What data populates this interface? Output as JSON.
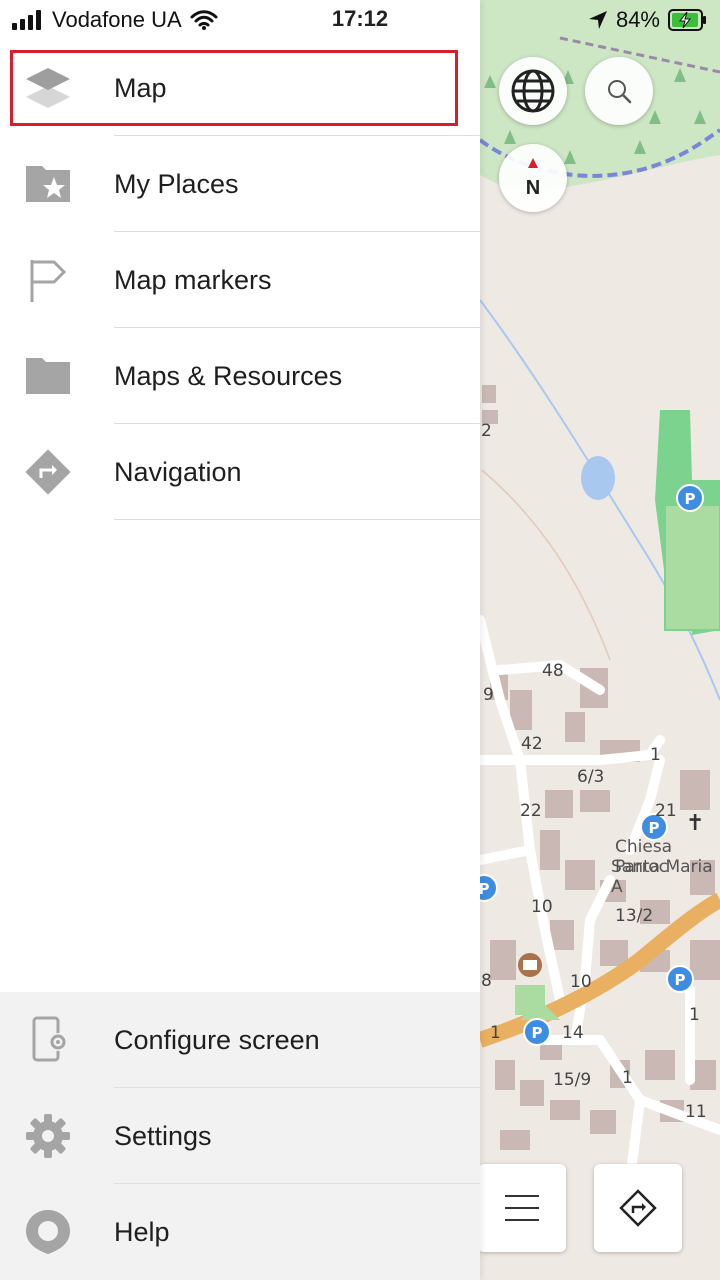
{
  "status_bar": {
    "carrier": "Vodafone UA",
    "time": "17:12",
    "battery": "84%"
  },
  "menu": {
    "items": [
      {
        "label": "Map",
        "icon": "layers-icon"
      },
      {
        "label": "My Places",
        "icon": "star-folder-icon"
      },
      {
        "label": "Map markers",
        "icon": "flag-icon"
      },
      {
        "label": "Maps & Resources",
        "icon": "folder-icon"
      },
      {
        "label": "Navigation",
        "icon": "navigation-icon"
      }
    ],
    "bottom_items": [
      {
        "label": "Configure screen",
        "icon": "configure-screen-icon"
      },
      {
        "label": "Settings",
        "icon": "gear-icon"
      },
      {
        "label": "Help",
        "icon": "help-icon"
      }
    ]
  },
  "map": {
    "labels": [
      "2",
      "48",
      "9",
      "42",
      "1",
      "6/3",
      "22",
      "21",
      "Chiesa Parroc",
      "Santa Maria A",
      "10",
      "13/2",
      "8",
      "10",
      "14",
      "1",
      "1",
      "15/9",
      "1",
      "11"
    ],
    "compass_label": "N",
    "colors": {
      "land": "#efe9e4",
      "forest": "#cde6c4",
      "park": "#7cd38e",
      "pitch": "#aadca1",
      "building": "#c9b8b4",
      "road": "#ffffff",
      "main_road": "#e8b060",
      "water": "#a8c8f0",
      "parking": "#3e8de0"
    }
  },
  "accent": "#d81e2c"
}
